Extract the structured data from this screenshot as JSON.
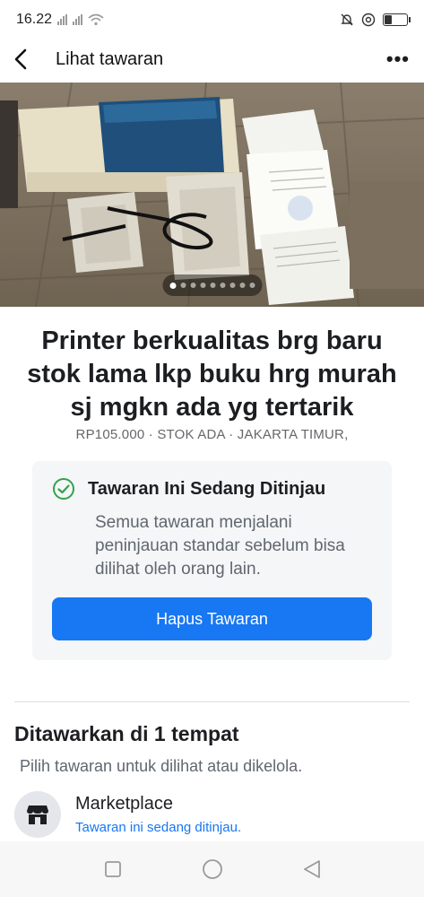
{
  "status_bar": {
    "time": "16.22",
    "battery_level": 0.35,
    "icons": [
      "signal-icon",
      "signal-icon",
      "wifi-icon",
      "mute-icon",
      "at-icon",
      "battery-icon"
    ]
  },
  "header": {
    "title": "Lihat tawaran",
    "back_icon": "back-arrow-icon",
    "more_label": "•••"
  },
  "photo": {
    "page_count": 9,
    "active_index": 0
  },
  "listing": {
    "title": "Printer berkualitas brg baru stok lama lkp buku hrg murah sj mgkn ada yg tertarik",
    "meta": "RP105.000 · STOK ADA · JAKARTA TIMUR,"
  },
  "review_card": {
    "title": "Tawaran Ini Sedang Ditinjau",
    "description": "Semua tawaran menjalani peninjauan standar sebelum bisa dilihat oleh orang lain.",
    "button_label": "Hapus Tawaran"
  },
  "offered": {
    "heading": "Ditawarkan di 1 tempat",
    "subheading": "Pilih tawaran untuk dilihat atau dikelola.",
    "places": [
      {
        "name": "Marketplace",
        "status": "Tawaran ini sedang ditinjau."
      }
    ]
  },
  "colors": {
    "accent": "#1877f2",
    "check_green": "#31a24c",
    "card_bg": "#f5f6f7"
  }
}
